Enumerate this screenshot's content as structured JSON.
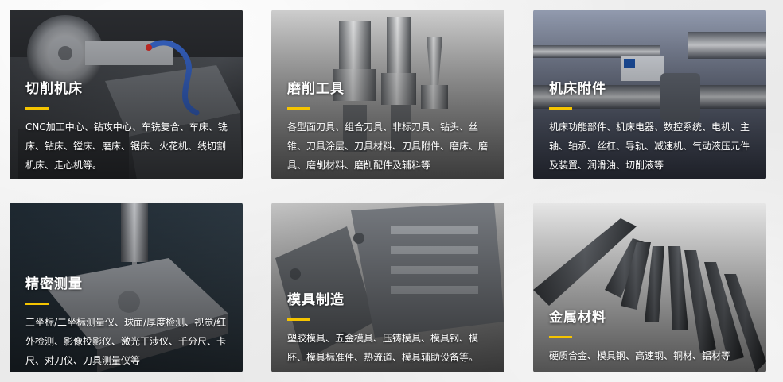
{
  "categories": [
    {
      "title": "切削机床",
      "description": "CNC加工中心、钻攻中心、车铣复合、车床、铣床、钻床、镗床、磨床、锯床、火花机、线切割机床、走心机等。",
      "image": "cnc-lathe-photo"
    },
    {
      "title": "磨削工具",
      "description": "各型面刀具、组合刀具、非标刀具、钻头、丝锥、刀具涂层、刀具材料、刀具附件、磨床、磨具、磨削材料、磨削配件及辅料等",
      "image": "tool-holders-photo"
    },
    {
      "title": "机床附件",
      "description": "机床功能部件、机床电器、数控系统、电机、主轴、轴承、丝杠、导轨、减速机、气动液压元件及装置、润滑油、切削液等",
      "image": "ball-screws-photo"
    },
    {
      "title": "精密测量",
      "description": "三坐标/二坐标测量仪、球面/厚度检测、视觉/红外检测、影像投影仪、激光干涉仪、千分尺、卡尺、对刀仪、刀具测量仪等",
      "image": "cmm-probe-photo"
    },
    {
      "title": "模具制造",
      "description": "塑胶模具、五金模具、压铸模具、模具钢、模胚、模具标准件、热流道、模具辅助设备等。",
      "image": "mold-photo"
    },
    {
      "title": "金属材料",
      "description": "硬质合金、模具钢、高速钢、铜材、铝材等",
      "image": "steel-bars-photo"
    }
  ],
  "colors": {
    "accent": "#f5c400",
    "text": "#ffffff",
    "page_background": "#ececec"
  }
}
